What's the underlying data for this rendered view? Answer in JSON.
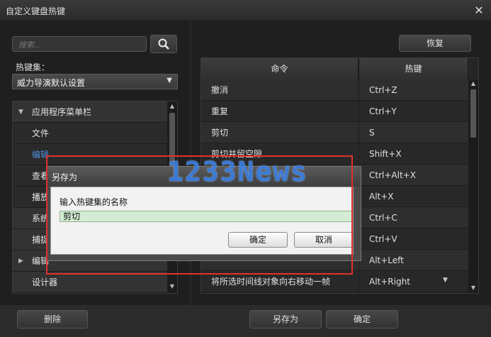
{
  "window": {
    "title": "自定义键盘热键"
  },
  "search": {
    "placeholder": "搜索..."
  },
  "hotkey_set": {
    "label": "热键集：",
    "selected": "威力导演默认设置"
  },
  "restore_label": "恢复",
  "tree": {
    "items": [
      {
        "label": "应用程序菜单栏",
        "type": "header",
        "expanded": true
      },
      {
        "label": "文件",
        "type": "child"
      },
      {
        "label": "编辑",
        "type": "child",
        "selected": true
      },
      {
        "label": "查看",
        "type": "child"
      },
      {
        "label": "播放",
        "type": "child"
      },
      {
        "label": "系统",
        "type": "header"
      },
      {
        "label": "捕捉",
        "type": "header"
      },
      {
        "label": "编辑",
        "type": "header",
        "expanded": false
      },
      {
        "label": "设计器",
        "type": "header"
      }
    ]
  },
  "table": {
    "headers": {
      "command": "命令",
      "hotkey": "热键"
    },
    "rows": [
      {
        "command": "撤消",
        "hotkey": "Ctrl+Z"
      },
      {
        "command": "重复",
        "hotkey": "Ctrl+Y"
      },
      {
        "command": "剪切",
        "hotkey": "S"
      },
      {
        "command": "剪切并留空隙",
        "hotkey": "Shift+X"
      },
      {
        "command": "",
        "hotkey": "Ctrl+Alt+X"
      },
      {
        "command": "",
        "hotkey": "Alt+X"
      },
      {
        "command": "",
        "hotkey": "Ctrl+C"
      },
      {
        "command": "",
        "hotkey": "Ctrl+V"
      },
      {
        "command": "",
        "hotkey": "Alt+Left"
      },
      {
        "command": "将所选时间线对象向右移动一帧",
        "hotkey": "Alt+Right"
      }
    ]
  },
  "footer": {
    "delete_label": "删除",
    "save_as_label": "另存为",
    "ok_label": "确定"
  },
  "dialog": {
    "title": "另存为",
    "prompt": "输入热键集的名称",
    "input_value": "剪切",
    "ok_label": "确定",
    "cancel_label": "取消"
  },
  "watermark": {
    "text": "1233News"
  },
  "colors": {
    "highlight_text": "#4f8fe0",
    "frame": "#e03030",
    "input_bg": "#d3ecd3"
  }
}
